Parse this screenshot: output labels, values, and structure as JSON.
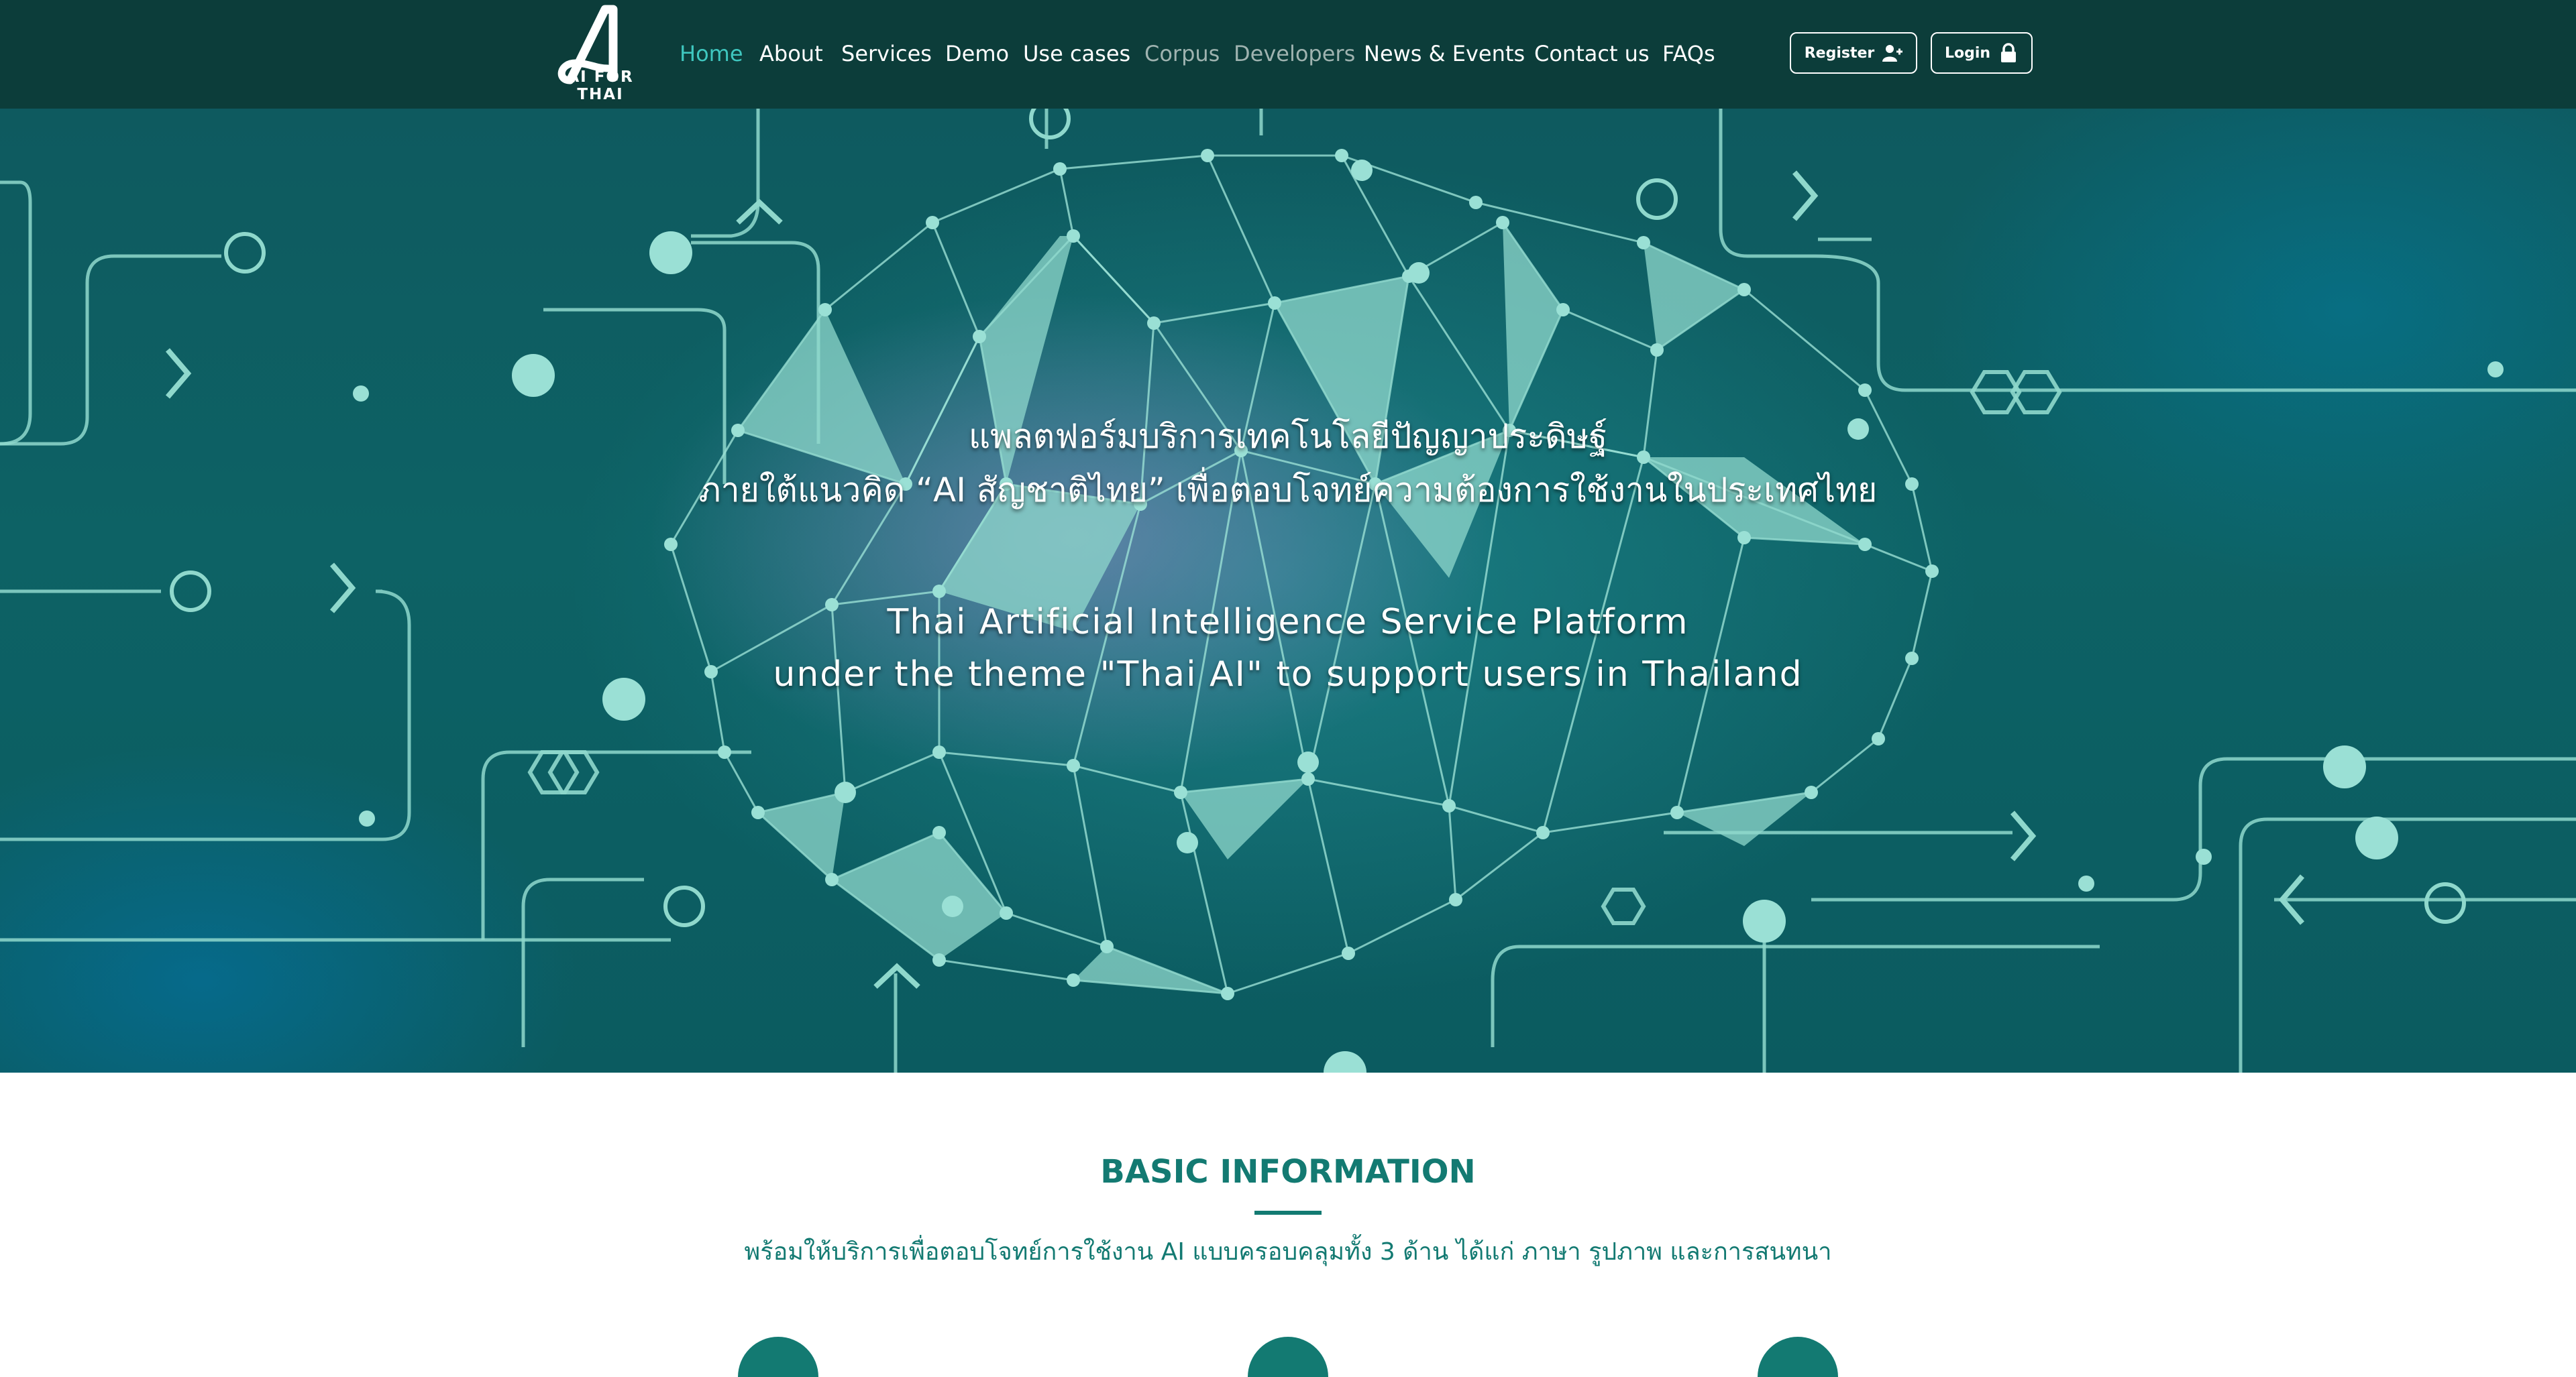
{
  "brand": {
    "logo_text": "AI FOR THAI"
  },
  "nav": {
    "items": [
      {
        "label": "Home",
        "state": "active"
      },
      {
        "label": "About",
        "state": "normal"
      },
      {
        "label": "Services",
        "state": "normal"
      },
      {
        "label": "Demo",
        "state": "normal"
      },
      {
        "label": "Use cases",
        "state": "normal"
      },
      {
        "label": "Corpus",
        "state": "muted"
      },
      {
        "label": "Developers",
        "state": "muted"
      },
      {
        "label": "News & Events",
        "state": "normal"
      },
      {
        "label": "Contact us",
        "state": "normal"
      },
      {
        "label": "FAQs",
        "state": "normal"
      }
    ],
    "register_label": "Register",
    "register_icon": "add-user-icon",
    "login_label": "Login",
    "login_icon": "lock-icon"
  },
  "hero": {
    "thai_line1": "แพลตฟอร์มบริการเทคโนโลยีปัญญาประดิษฐ์",
    "thai_line2": "ภายใต้แนวคิด “AI สัญชาติไทย” เพื่อตอบโจทย์ความต้องการใช้งานในประเทศไทย",
    "en_line1": "Thai Artificial Intelligence Service Platform",
    "en_line2": "under the theme \"Thai AI\" to support users in Thailand",
    "background_image": "brain-network-circuit-illustration"
  },
  "basic_info": {
    "title": "BASIC INFORMATION",
    "subtitle": "พร้อมให้บริการเพื่อตอบโจทย์การใช้งาน AI แบบครอบคลุมทั้ง 3 ด้าน ได้แก่ ภาษา รูปภาพ และการสนทนา"
  },
  "colors": {
    "navbar_bg": "#0c3d3a",
    "nav_active": "#3fc7bf",
    "nav_muted": "#9fb3b0",
    "accent": "#137a72",
    "hero_bg": "#0d6265",
    "network_line": "#8fd8cc"
  }
}
